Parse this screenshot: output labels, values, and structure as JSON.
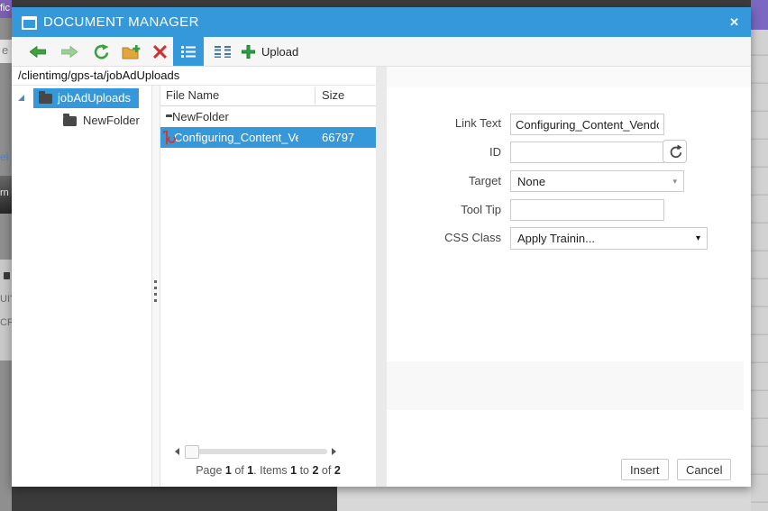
{
  "backdrop": {
    "fragments": {
      "f1": "fic",
      "f2": "e",
      "f3": "el",
      "f4": "rn",
      "f5": "UI'",
      "f6": "CRI"
    }
  },
  "dialog": {
    "title": "DOCUMENT MANAGER",
    "icons": {
      "close": "✕",
      "combo_caret": "▾",
      "dropdown_caret": "▾"
    },
    "toolbar": {
      "upload_label": "Upload"
    },
    "path": "/clientimg/gps-ta/jobAdUploads",
    "tree": {
      "items": [
        {
          "label": "jobAdUploads",
          "selected": true
        },
        {
          "label": "NewFolder",
          "selected": false
        }
      ]
    },
    "grid": {
      "columns": [
        "File Name",
        "Size"
      ],
      "rows": [
        {
          "name": "NewFolder",
          "size": "",
          "type": "folder",
          "selected": false
        },
        {
          "name": "Configuring_Content_Vendo",
          "size": "66797",
          "type": "pdf",
          "selected": true
        }
      ]
    },
    "pager": {
      "p1": "Page ",
      "n1": "1",
      "p2": " of ",
      "n2": "1",
      "p3": ". Items ",
      "n3": "1",
      "p4": " to ",
      "n4": "2",
      "p5": " of ",
      "n5": "2"
    },
    "form": {
      "link_text": {
        "label": "Link Text",
        "value": "Configuring_Content_Vendor"
      },
      "id_field": {
        "label": "ID",
        "value": ""
      },
      "target": {
        "label": "Target",
        "value": "None"
      },
      "tool_tip": {
        "label": "Tool Tip",
        "value": ""
      },
      "css_class": {
        "label": "CSS Class",
        "value": "Apply Trainin..."
      }
    },
    "footer": {
      "insert_label": "Insert",
      "cancel_label": "Cancel"
    }
  },
  "colors": {
    "titlebar_blue": "#3498db",
    "selection_blue": "#3498db",
    "backdrop_gray": "#3b3b3b",
    "purple_fragment": "#7b68c2",
    "toolbar_green": "#3aa13a",
    "delete_red": "#cc3333",
    "folder_yellow": "#e2a63d"
  }
}
